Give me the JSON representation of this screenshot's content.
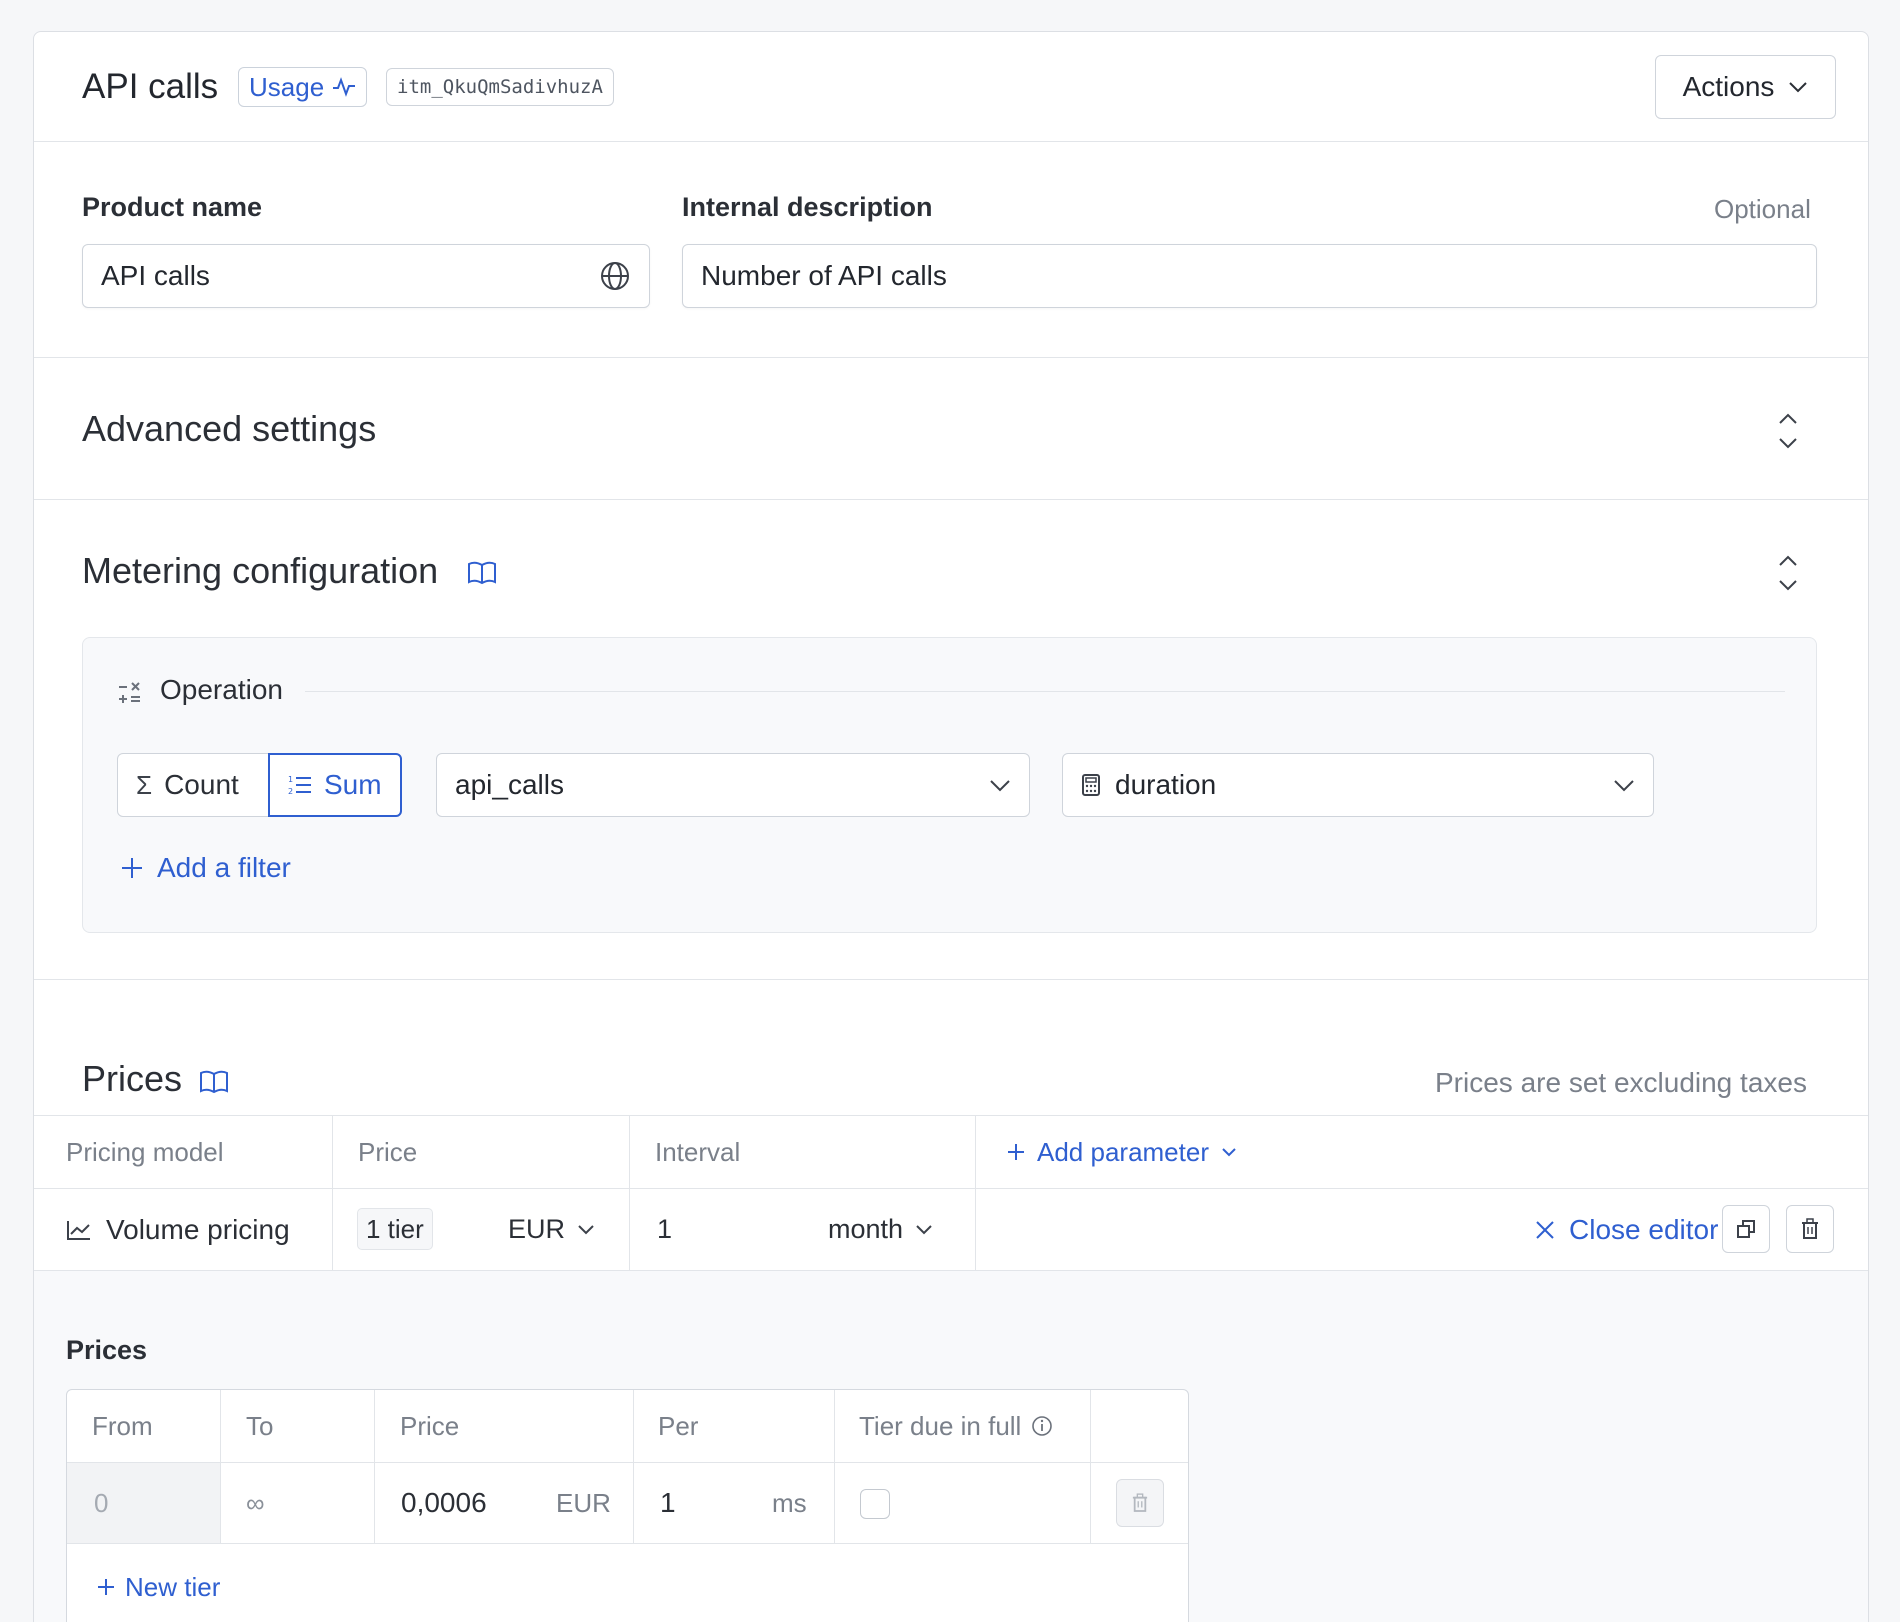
{
  "header": {
    "title": "API calls",
    "type_badge": "Usage",
    "item_id": "itm_QkuQmSadivhuzA",
    "actions_label": "Actions"
  },
  "product": {
    "name_label": "Product name",
    "name_value": "API calls",
    "description_label": "Internal description",
    "description_optional": "Optional",
    "description_value": "Number of API calls"
  },
  "advanced": {
    "title": "Advanced settings"
  },
  "metering": {
    "title": "Metering configuration",
    "operation_label": "Operation",
    "op_count": "Count",
    "op_sum": "Sum",
    "op_selected": "Sum",
    "event_select": "api_calls",
    "property_select": "duration",
    "add_filter": "Add a filter"
  },
  "prices": {
    "title": "Prices",
    "note": "Prices are set excluding taxes",
    "columns": [
      "Pricing model",
      "Price",
      "Interval"
    ],
    "add_parameter": "Add parameter",
    "row": {
      "model": "Volume pricing",
      "tiers": "1 tier",
      "currency": "EUR",
      "interval_count": "1",
      "interval_unit": "month",
      "close_editor": "Close editor"
    },
    "editor": {
      "title": "Prices",
      "columns": [
        "From",
        "To",
        "Price",
        "Per",
        "Tier due in full"
      ],
      "tier": {
        "from": "0",
        "to": "∞",
        "price": "0,0006",
        "currency": "EUR",
        "per": "1",
        "per_unit": "ms",
        "due_in_full": false
      },
      "new_tier": "New tier"
    }
  },
  "colors": {
    "accent": "#2f5fd0",
    "border": "#cfd4db",
    "text": "#23272e",
    "muted": "#7a808a"
  }
}
